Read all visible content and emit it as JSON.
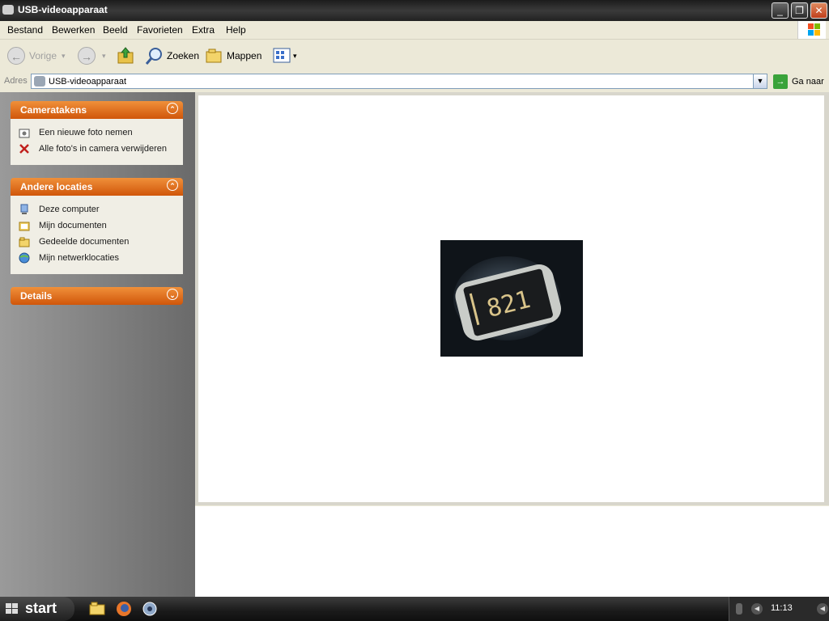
{
  "window": {
    "title": "USB-videoapparaat"
  },
  "menu": [
    "Bestand",
    "Bewerken",
    "Beeld",
    "Favorieten",
    "Extra",
    "Help"
  ],
  "toolbar": {
    "back": "Vorige",
    "search": "Zoeken",
    "folders": "Mappen"
  },
  "address": {
    "label": "Adres",
    "value": "USB-videoapparaat",
    "go": "Ga naar"
  },
  "panels": [
    {
      "title": "Cameratakens",
      "items": [
        "Een nieuwe foto nemen",
        "Alle foto's in camera verwijderen"
      ]
    },
    {
      "title": "Andere locaties",
      "items": [
        "Deze computer",
        "Mijn documenten",
        "Gedeelde documenten",
        "Mijn netwerklocaties"
      ]
    },
    {
      "title": "Details"
    }
  ],
  "photo": {
    "marking": "821"
  },
  "taskbar": {
    "start": "start",
    "clock": "11:13"
  }
}
